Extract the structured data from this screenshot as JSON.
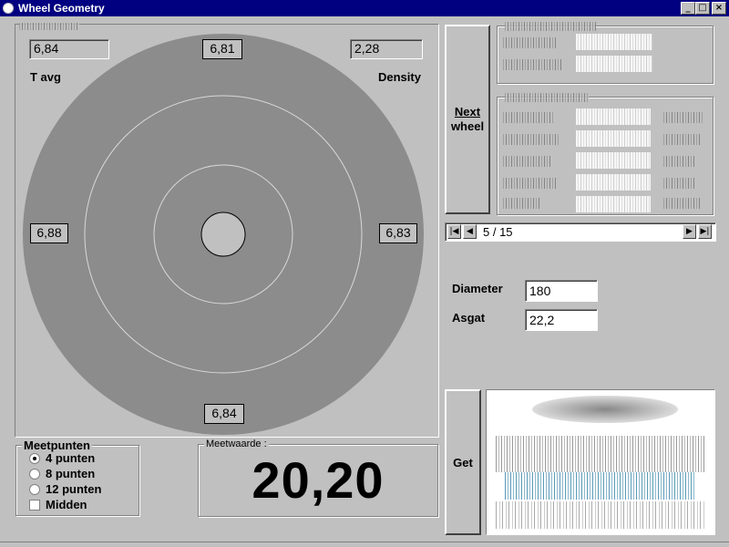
{
  "window": {
    "title": "Wheel Geometry"
  },
  "wheel": {
    "top_left_value": "6,84",
    "top_left_label": "T avg",
    "top_right_value": "2,28",
    "top_right_label": "Density",
    "top_value": "6,81",
    "left_value": "6,88",
    "right_value": "6,83",
    "bottom_value": "6,84"
  },
  "meetpunten": {
    "title": "Meetpunten",
    "options": [
      {
        "label": "4 punten",
        "selected": true
      },
      {
        "label": "8 punten",
        "selected": false
      },
      {
        "label": "12 punten",
        "selected": false
      }
    ],
    "midden_label": "Midden",
    "midden_checked": false
  },
  "meetwaarde": {
    "title": "Meetwaarde :",
    "value": "20,20"
  },
  "next_wheel_button": {
    "label_line1": "Next",
    "label_line2": "wheel"
  },
  "navigator": {
    "position": "5 / 15"
  },
  "diameter": {
    "label": "Diameter",
    "value": "180"
  },
  "asgat": {
    "label": "Asgat",
    "value": "22,2"
  },
  "get_button": {
    "label": "Get"
  },
  "colors": {
    "titlebar": "#000080",
    "face": "#c0c0c0",
    "wheel": "#8c8c8c"
  },
  "icons": [
    "app-icon",
    "minimize-icon",
    "maximize-icon",
    "close-icon",
    "first-record-icon",
    "prev-record-icon",
    "next-record-icon",
    "last-record-icon"
  ]
}
